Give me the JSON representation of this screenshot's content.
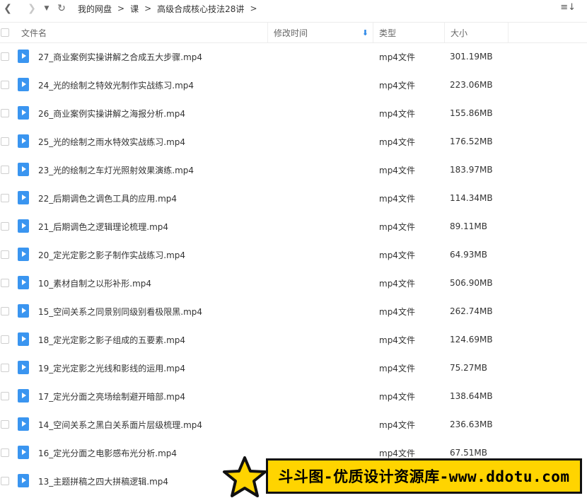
{
  "toolbar": {
    "breadcrumbs": [
      "我的网盘",
      "课",
      "高级合成核心技法28讲"
    ]
  },
  "columns": {
    "name": "文件名",
    "modified": "修改时间",
    "type": "类型",
    "size": "大小"
  },
  "files": [
    {
      "name": "27_商业案例实操讲解之合成五大步骤.mp4",
      "type": "mp4文件",
      "size": "301.19MB"
    },
    {
      "name": "24_光的绘制之特效光制作实战练习.mp4",
      "type": "mp4文件",
      "size": "223.06MB"
    },
    {
      "name": "26_商业案例实操讲解之海报分析.mp4",
      "type": "mp4文件",
      "size": "155.86MB"
    },
    {
      "name": "25_光的绘制之雨水特效实战练习.mp4",
      "type": "mp4文件",
      "size": "176.52MB"
    },
    {
      "name": "23_光的绘制之车灯光照射效果演练.mp4",
      "type": "mp4文件",
      "size": "183.97MB"
    },
    {
      "name": "22_后期调色之调色工具的应用.mp4",
      "type": "mp4文件",
      "size": "114.34MB"
    },
    {
      "name": "21_后期调色之逻辑理论梳理.mp4",
      "type": "mp4文件",
      "size": "89.11MB"
    },
    {
      "name": "20_定光定影之影子制作实战练习.mp4",
      "type": "mp4文件",
      "size": "64.93MB"
    },
    {
      "name": "10_素材自制之以形补形.mp4",
      "type": "mp4文件",
      "size": "506.90MB"
    },
    {
      "name": "15_空间关系之同景别同级别看极限黑.mp4",
      "type": "mp4文件",
      "size": "262.74MB"
    },
    {
      "name": "18_定光定影之影子组成的五要素.mp4",
      "type": "mp4文件",
      "size": "124.69MB"
    },
    {
      "name": "19_定光定影之光线和影线的运用.mp4",
      "type": "mp4文件",
      "size": "75.27MB"
    },
    {
      "name": "17_定光分面之亮场绘制避开暗部.mp4",
      "type": "mp4文件",
      "size": "138.64MB"
    },
    {
      "name": "14_空间关系之黑白关系面片层级梳理.mp4",
      "type": "mp4文件",
      "size": "236.63MB"
    },
    {
      "name": "16_定光分面之电影感布光分析.mp4",
      "type": "mp4文件",
      "size": "67.51MB"
    },
    {
      "name": "13_主题拼稿之四大拼稿逻辑.mp4",
      "type": "",
      "size": ""
    }
  ],
  "watermark": {
    "text": "斗斗图-优质设计资源库-www.ddotu.com"
  }
}
